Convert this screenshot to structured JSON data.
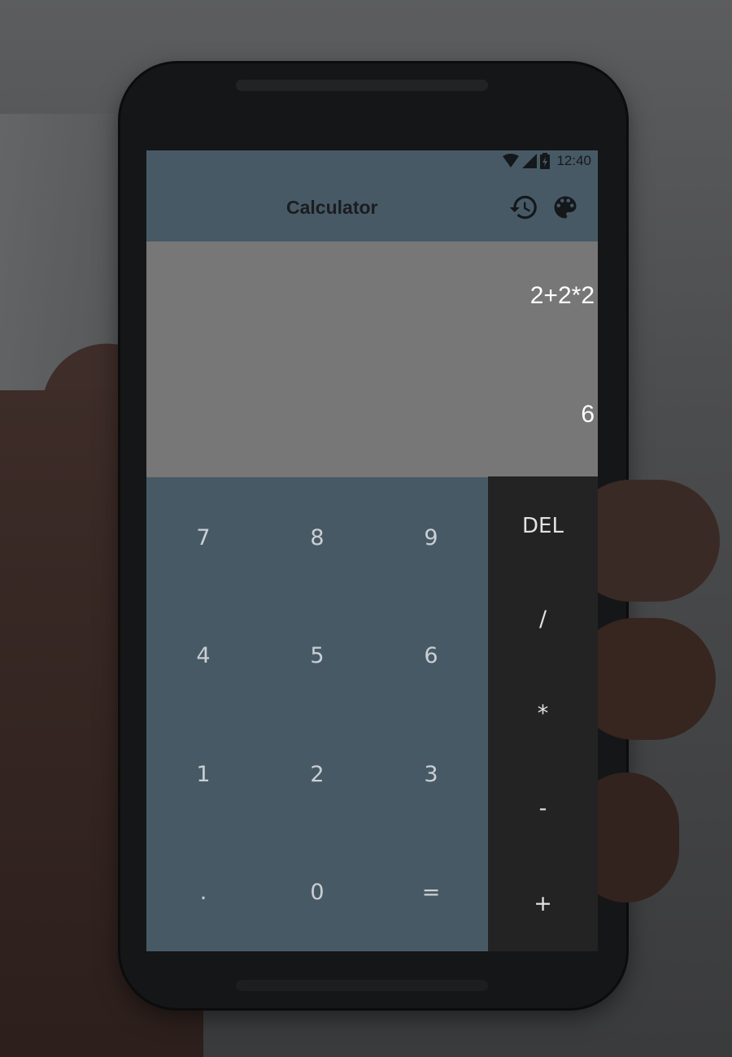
{
  "status_bar": {
    "time": "12:40",
    "icons": [
      "wifi-icon",
      "cell-signal-icon",
      "battery-charging-icon"
    ]
  },
  "app": {
    "title": "Calculator",
    "toolbar_icons": [
      "history-icon",
      "palette-icon"
    ]
  },
  "display": {
    "expression": "2+2*2",
    "result": "6"
  },
  "keypad": {
    "digits": [
      "7",
      "8",
      "9",
      "4",
      "5",
      "6",
      "1",
      "2",
      "3",
      ".",
      "0",
      "="
    ],
    "operators": [
      "DEL",
      "/",
      "*",
      "-",
      "+"
    ]
  },
  "colors": {
    "toolbar": "#485966",
    "display_bg": "#777777",
    "numpad_bg": "#485966",
    "ops_bg": "#232323",
    "display_text": "#ffffff"
  }
}
